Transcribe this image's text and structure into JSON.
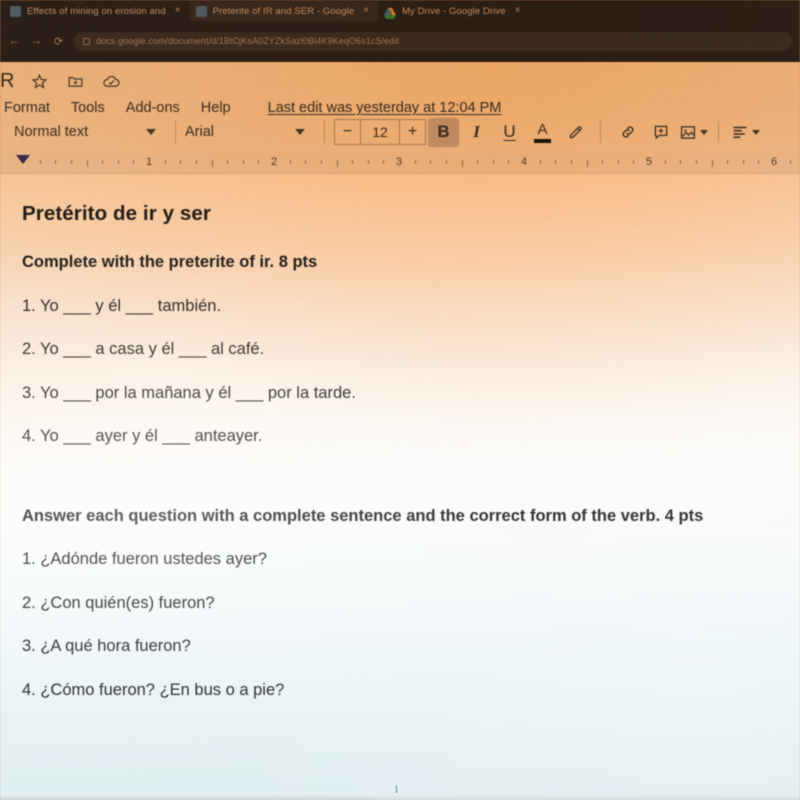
{
  "browser": {
    "tabs": [
      {
        "title": "Effects of mining on erosion and",
        "favicon": "document-favicon",
        "close": "×"
      },
      {
        "title": "Preterite of IR and SER - Google",
        "favicon": "document-favicon",
        "close": "×"
      },
      {
        "title": "My Drive - Google Drive",
        "favicon": "drive-favicon",
        "close": "×"
      }
    ],
    "nav": {
      "back": "←",
      "forward": "→",
      "reload": "⟳"
    },
    "omnibox": {
      "url": "docs.google.com/document/d/1BtCjKsA0ZYZkSazl0Bl4K9KeqO6s1cS/edit",
      "lock_icon": "lock-icon"
    }
  },
  "docs": {
    "doc_title": "R",
    "header_icons": [
      "star-icon",
      "move-to-folder-icon",
      "cloud-saved-icon"
    ],
    "menus": [
      "Format",
      "Tools",
      "Add-ons",
      "Help"
    ],
    "last_edit": "Last edit was yesterday at 12:04 PM",
    "toolbar": {
      "paragraph_style": "Normal text",
      "font_family": "Arial",
      "font_size": "12",
      "decrease_label": "−",
      "increase_label": "+",
      "bold_label": "B",
      "italic_label": "I",
      "underline_label": "U",
      "text_color_label": "A",
      "text_color_hex": "#1b1b1b",
      "highlight_icon": "highlighter-icon",
      "link_icon": "link-icon",
      "comment_icon": "add-comment-icon",
      "image_icon": "insert-image-icon",
      "align_icon": "align-icon"
    },
    "ruler": {
      "numbers": [
        "1",
        "2",
        "3",
        "4",
        "5",
        "6"
      ],
      "indent_marker": "left-indent-marker"
    }
  },
  "document": {
    "heading": "Pretérito de ir y ser",
    "section1": {
      "instruction": "Complete with the preterite of ir. 8 pts",
      "items": [
        "1. Yo ___ y él ___ también.",
        "2. Yo ___ a casa y él ___ al café.",
        "3. Yo ___ por la mañana y él ___ por la tarde.",
        "4. Yo ___ ayer y él ___ anteayer."
      ]
    },
    "section2": {
      "instruction": "Answer each question with a complete sentence and the correct form of the verb. 4 pts",
      "items": [
        "1. ¿Adónde fueron ustedes ayer?",
        "2. ¿Con quién(es) fueron?",
        "3. ¿A qué hora fueron?",
        "4. ¿Cómo fueron? ¿En bus o a pie?"
      ]
    },
    "text_cursor": "I"
  },
  "colors": {
    "chrome_bg": "#2c2b30",
    "docs_bg": "#f3f2f0",
    "page_bg": "#ffffff",
    "text": "#262626",
    "photo_warm": "#ec8e34",
    "photo_cool": "#acd0da"
  }
}
